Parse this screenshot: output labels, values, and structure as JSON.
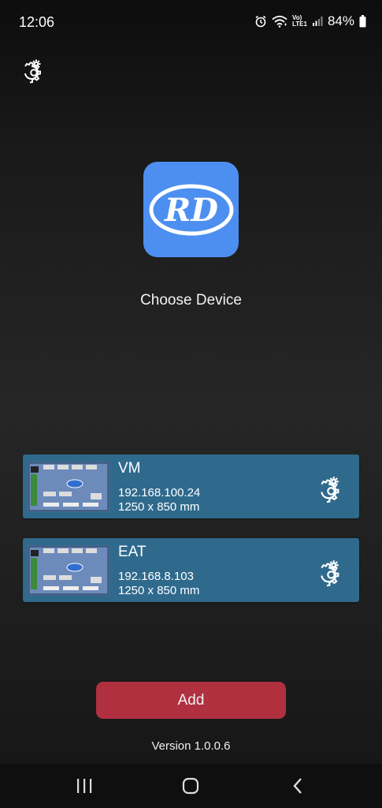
{
  "status_bar": {
    "time": "12:06",
    "battery_percent": "84%",
    "network_label_top": "Vo)",
    "network_label_bottom": "LTE1",
    "icons": [
      "alarm-icon",
      "wifi-icon",
      "volte-icon",
      "signal-icon",
      "battery-icon"
    ]
  },
  "header": {
    "settings_icon": "gear-icon"
  },
  "logo": {
    "text": "RD",
    "background_color": "#4d8ff0"
  },
  "title": "Choose Device",
  "devices": [
    {
      "name": "VM",
      "ip": "192.168.100.24",
      "size": "1250 x 850 mm"
    },
    {
      "name": "EAT",
      "ip": "192.168.8.103",
      "size": "1250 x 850 mm"
    }
  ],
  "card_color": "#2f6a8d",
  "add_button": {
    "label": "Add",
    "color": "#b03040"
  },
  "version": "Version 1.0.0.6",
  "nav_bar": {
    "icons": [
      "recent-apps-icon",
      "home-icon",
      "back-icon"
    ]
  }
}
